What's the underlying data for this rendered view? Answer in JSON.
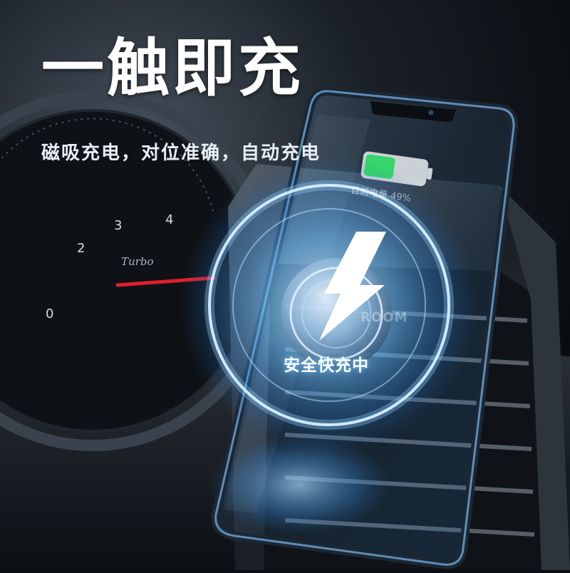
{
  "headline": "一触即充",
  "subline": "磁吸充电，对位准确，自动充电",
  "phone": {
    "battery_text": "目前电量 49%",
    "battery_level": 0.49,
    "battery_color": "#37d66b"
  },
  "charger": {
    "brand_text": "ROOM",
    "status_text": "安全快充中",
    "glow_color": "#4aa8ff"
  },
  "gauge": {
    "ticks": [
      "4",
      "3",
      "2",
      "0"
    ],
    "brand": "Turbo"
  }
}
